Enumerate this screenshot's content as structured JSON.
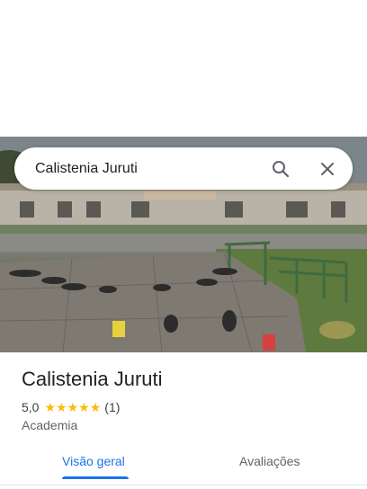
{
  "search": {
    "query": "Calistenia Juruti"
  },
  "place": {
    "name": "Calistenia Juruti",
    "rating": "5,0",
    "stars": 5,
    "review_count": "(1)",
    "category": "Academia"
  },
  "tabs": [
    {
      "label": "Visão geral",
      "active": true
    },
    {
      "label": "Avaliações",
      "active": false
    }
  ],
  "icons": {
    "search": "search-icon",
    "close": "close-icon",
    "star": "star-icon"
  },
  "colors": {
    "accent": "#1a73e8",
    "star": "#fbbc04"
  }
}
